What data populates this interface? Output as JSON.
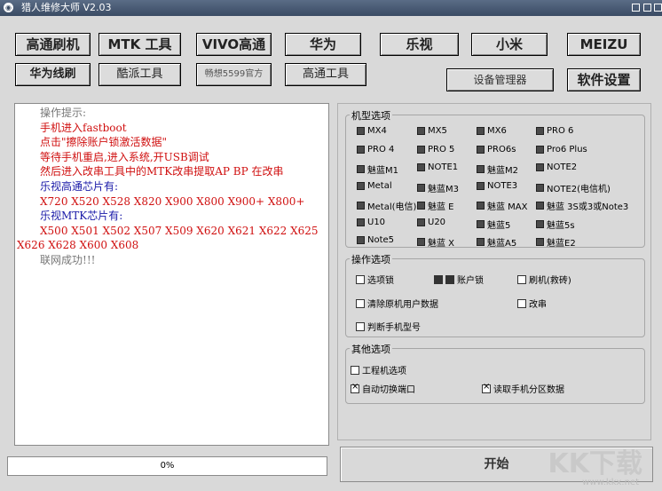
{
  "window": {
    "title": "猎人维修大师 V2.03"
  },
  "toolbar": {
    "row1": [
      "高通刷机",
      "MTK 工具",
      "VIVO高通",
      "华为",
      "乐视",
      "小米",
      "MEIZU"
    ],
    "row2": [
      "华为线刷",
      "酷派工具",
      "畅想5599官方",
      "高通工具"
    ],
    "device_manager": "设备管理器",
    "settings": "软件设置"
  },
  "log": [
    {
      "text": "操作提示:",
      "color": "gray",
      "indent": 1
    },
    {
      "text": "手机进入fastboot",
      "color": "red",
      "indent": 1
    },
    {
      "text": "点击\"擦除账户锁激活数据\"",
      "color": "red",
      "indent": 1
    },
    {
      "text": "等待手机重启,进入系统,开USB调试",
      "color": "red",
      "indent": 1
    },
    {
      "text": "然后进入改串工具中的MTK改串提取AP BP 在改串",
      "color": "red",
      "indent": 1
    },
    {
      "text": "乐视高通芯片有:",
      "color": "blue",
      "indent": 1
    },
    {
      "text": "X720  X520  X528  X820  X900  X800  X900+  X800+",
      "color": "red",
      "indent": 1
    },
    {
      "text": "乐视MTK芯片有:",
      "color": "blue",
      "indent": 1
    },
    {
      "text": "X500 X501 X502 X507 X509 X620 X621 X622 X625",
      "color": "red",
      "indent": 1
    },
    {
      "text": "X626 X628 X600 X608",
      "color": "red",
      "indent": 0
    },
    {
      "text": "联网成功!!!",
      "color": "gray",
      "indent": 1
    }
  ],
  "progress": {
    "value": 0,
    "label": "0%"
  },
  "model_group": {
    "title": "机型选项",
    "options": [
      "MX4",
      "MX5",
      "MX6",
      "PRO 6",
      "PRO 4",
      "PRO 5",
      "PRO6s",
      "Pro6 Plus",
      "魅蓝M1",
      "NOTE1",
      "魅蓝M2",
      "NOTE2",
      "Metal",
      "魅蓝M3",
      "NOTE3",
      "NOTE2(电信机)",
      "Metal(电信)",
      "魅蓝 E",
      "魅蓝 MAX",
      "魅蓝 3S或3或Note3",
      "U10",
      "U20",
      "魅蓝5",
      "魅蓝5s",
      "Note5",
      "魅蓝 X",
      "魅蓝A5",
      "魅蓝E2"
    ]
  },
  "op_group": {
    "title": "操作选项",
    "options": [
      "选项锁",
      "账户锁",
      "刷机(救砖)",
      "清除原机用户数据",
      "改串",
      "判断手机型号"
    ]
  },
  "other_group": {
    "title": "其他选项",
    "options": [
      {
        "label": "工程机选项",
        "checked": false
      },
      {
        "label": "自动切换端口",
        "checked": true
      },
      {
        "label": "读取手机分区数据",
        "checked": true
      }
    ]
  },
  "start": "开始",
  "watermark": {
    "text": "KK下载",
    "url": "www.kkx.net"
  }
}
